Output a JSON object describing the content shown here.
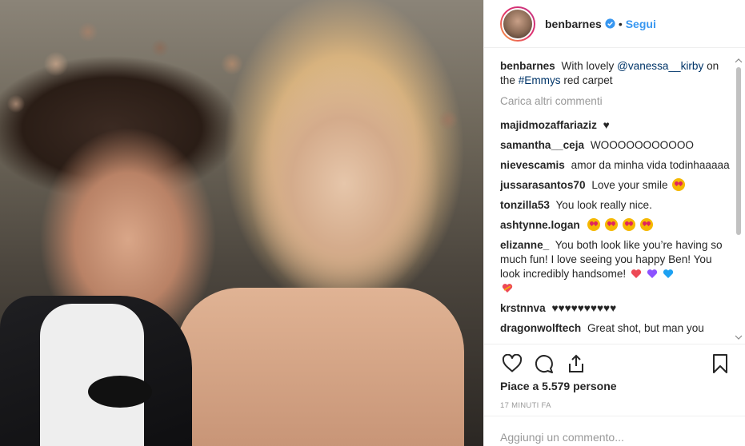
{
  "post": {
    "username": "benbarnes",
    "follow_label": "Segui",
    "dot": "•",
    "caption": {
      "user": "benbarnes",
      "text_before": "With lovely",
      "mention": "@vanessa__kirby",
      "text_mid": "on the",
      "hashtag": "#Emmys",
      "text_after": "red carpet"
    },
    "load_more": "Carica altri commenti",
    "comments": [
      {
        "user": "majidmozaffariaziz",
        "text": "♥"
      },
      {
        "user": "samantha__ceja",
        "text": "WOOOOOOOOOOO"
      },
      {
        "user": "nievescamis",
        "text": "amor da minha vida todinhaaaaa"
      },
      {
        "user": "jussarasantos70",
        "text": "Love your smile"
      },
      {
        "user": "tonzilla53",
        "text": "You look really nice."
      },
      {
        "user": "ashtynne.logan",
        "text": ""
      },
      {
        "user": "elizanne_",
        "text": "You both look like you’re having so much fun! I love seeing you happy Ben! You look incredibly handsome!"
      },
      {
        "user": "krstnnva",
        "text": "♥♥♥♥♥♥♥♥♥♥"
      },
      {
        "user": "dragonwolftech",
        "text": "Great shot, but man you"
      }
    ],
    "likes": "Piace a 5.579 persone",
    "time": "17 MINUTI FA",
    "add_comment_placeholder": "Aggiungi un commento..."
  },
  "colors": {
    "link": "#3897f0",
    "mention": "#003569",
    "heart_red": "#ed4956",
    "heart_purple": "#8c52ff",
    "heart_blue": "#1da1f2"
  }
}
